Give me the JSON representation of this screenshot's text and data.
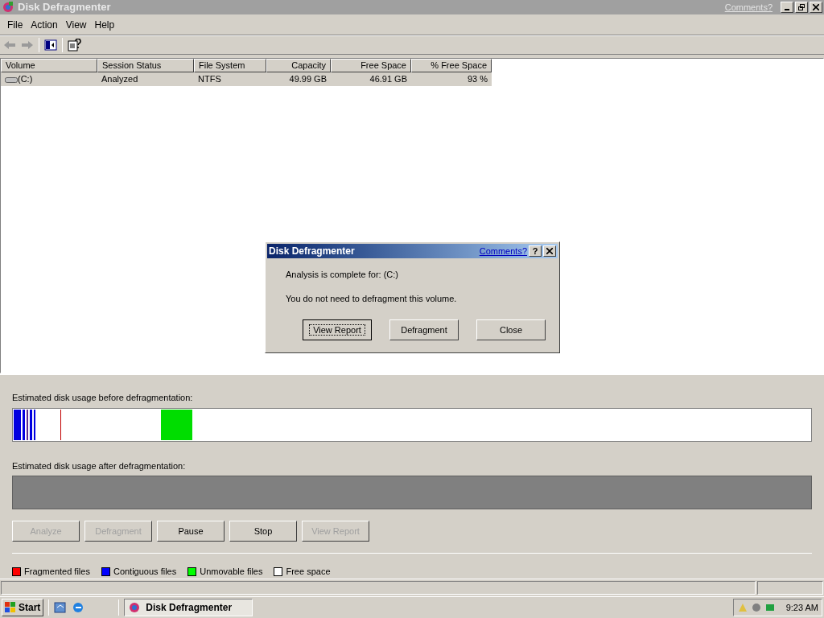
{
  "window": {
    "title": "Disk Defragmenter",
    "comments_link": "Comments?"
  },
  "menu": [
    "File",
    "Action",
    "View",
    "Help"
  ],
  "toolbar": [
    {
      "kind": "back",
      "disabled": true
    },
    {
      "kind": "forward",
      "disabled": true
    },
    {
      "kind": "panel",
      "disabled": false
    },
    {
      "kind": "help",
      "disabled": false
    }
  ],
  "table": {
    "columns": [
      {
        "label": "Volume",
        "kind": "text"
      },
      {
        "label": "Session Status",
        "kind": "text"
      },
      {
        "label": "File System",
        "kind": "text"
      },
      {
        "label": "Capacity",
        "kind": "number"
      },
      {
        "label": "Free Space",
        "kind": "number"
      },
      {
        "label": "% Free Space",
        "kind": "number"
      }
    ],
    "rows": [
      {
        "selected": true,
        "cells": [
          "(C:)",
          "Analyzed",
          "NTFS",
          "49.99 GB",
          "46.91 GB",
          "93 %"
        ]
      }
    ]
  },
  "dialog": {
    "title": "Disk Defragmenter",
    "comments_link": "Comments?",
    "help": "?",
    "lines": [
      "Analysis is complete for: (C:)",
      "You do not need to defragment this volume."
    ],
    "buttons": [
      {
        "label": "View Report",
        "focused": true
      },
      {
        "label": "Defragment",
        "focused": false
      },
      {
        "label": "Close",
        "focused": false
      }
    ]
  },
  "before_label": "Estimated disk usage before defragmentation:",
  "after_label": "Estimated disk usage after defragmentation:",
  "actions": [
    {
      "label": "Analyze",
      "disabled": true
    },
    {
      "label": "Defragment",
      "disabled": true
    },
    {
      "label": "Pause",
      "disabled": false
    },
    {
      "label": "Stop",
      "disabled": false
    },
    {
      "label": "View Report",
      "disabled": true
    }
  ],
  "legend": [
    {
      "label": "Fragmented files",
      "color": "#ff0000"
    },
    {
      "label": "Contiguous files",
      "color": "#0000ff"
    },
    {
      "label": "Unmovable files",
      "color": "#00ff00"
    },
    {
      "label": "Free space",
      "color": "#ffffff"
    }
  ],
  "taskbar": {
    "start": "Start",
    "tasks": [
      {
        "label": "Disk Defragmenter",
        "selected": true
      }
    ],
    "clock": "9:23 AM"
  }
}
